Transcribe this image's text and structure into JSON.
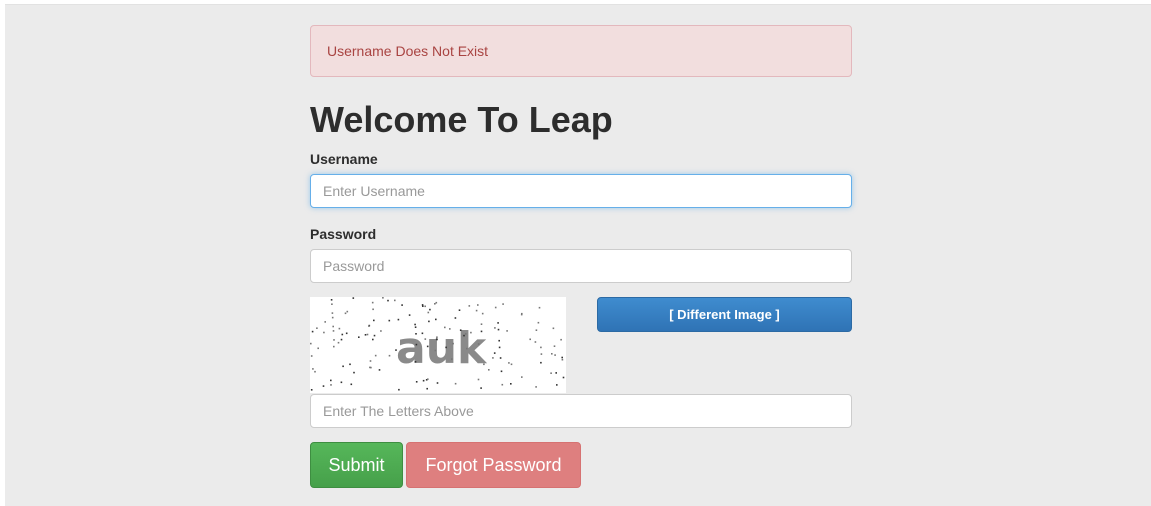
{
  "alert": {
    "message": "Username Does Not Exist",
    "color": "#a94442",
    "background": "#f2dede"
  },
  "page_title": "Welcome To Leap",
  "form": {
    "username": {
      "label": "Username",
      "placeholder": "Enter Username",
      "value": ""
    },
    "password": {
      "label": "Password",
      "placeholder": "Password",
      "value": ""
    },
    "captcha": {
      "text": "auk",
      "refresh_label": "[ Different Image ]",
      "input_placeholder": "Enter The Letters Above",
      "value": ""
    },
    "submit_label": "Submit",
    "forgot_label": "Forgot Password"
  },
  "colors": {
    "submit": "#4cae4c",
    "forgot": "#de7f7f",
    "primary": "#337ab7",
    "focus": "#66afe9"
  }
}
